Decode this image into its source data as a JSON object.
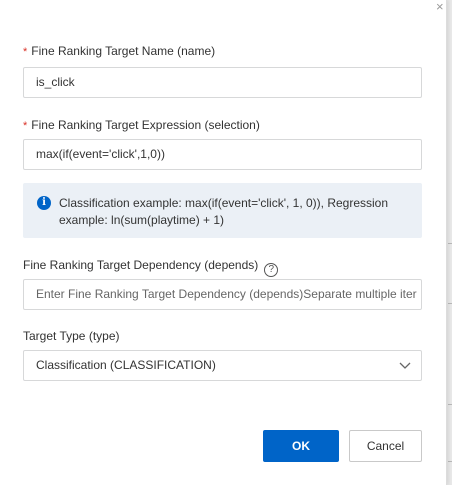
{
  "dialog": {
    "close_glyph": "×",
    "required_mark": "*",
    "fields": {
      "name": {
        "label": "Fine Ranking Target Name (name)",
        "value": "is_click"
      },
      "expression": {
        "label": "Fine Ranking Target Expression (selection)",
        "value": "max(if(event='click',1,0))"
      },
      "info": {
        "icon": "info-icon",
        "text": "Classification example: max(if(event='click', 1, 0)), Regression example: ln(sum(playtime) + 1)"
      },
      "depends": {
        "label": "Fine Ranking Target Dependency (depends)",
        "help_icon": "question-icon",
        "placeholder": "Enter Fine Ranking Target Dependency (depends)Separate multiple iter"
      },
      "type": {
        "label": "Target Type (type)",
        "selected": "Classification (CLASSIFICATION)",
        "icon": "chevron-down-icon"
      }
    },
    "buttons": {
      "ok": "OK",
      "cancel": "Cancel"
    }
  },
  "colors": {
    "primary": "#0064c8",
    "required": "#d93026",
    "info_background": "#ebf0f6"
  }
}
